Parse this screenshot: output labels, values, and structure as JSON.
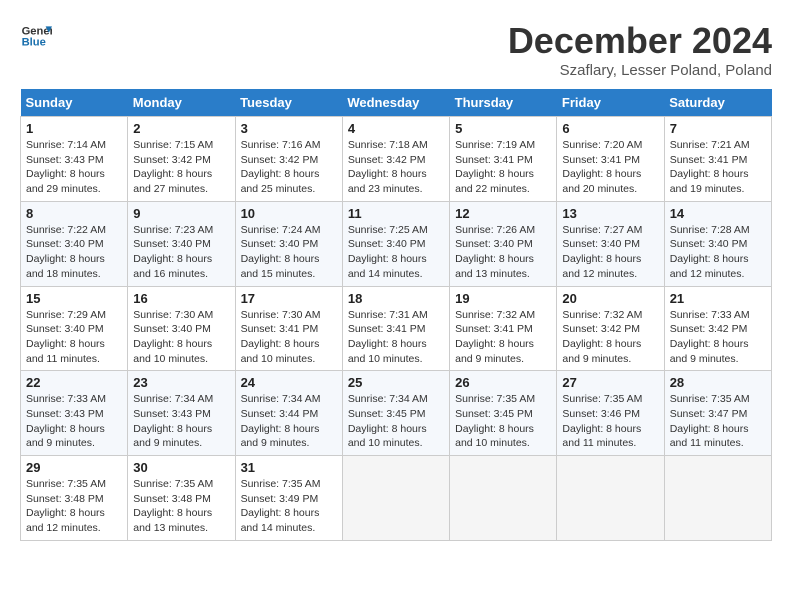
{
  "logo": {
    "line1": "General",
    "line2": "Blue"
  },
  "title": "December 2024",
  "subtitle": "Szaflary, Lesser Poland, Poland",
  "days_of_week": [
    "Sunday",
    "Monday",
    "Tuesday",
    "Wednesday",
    "Thursday",
    "Friday",
    "Saturday"
  ],
  "weeks": [
    [
      {
        "day": "1",
        "sunrise": "7:14 AM",
        "sunset": "3:43 PM",
        "daylight": "8 hours and 29 minutes."
      },
      {
        "day": "2",
        "sunrise": "7:15 AM",
        "sunset": "3:42 PM",
        "daylight": "8 hours and 27 minutes."
      },
      {
        "day": "3",
        "sunrise": "7:16 AM",
        "sunset": "3:42 PM",
        "daylight": "8 hours and 25 minutes."
      },
      {
        "day": "4",
        "sunrise": "7:18 AM",
        "sunset": "3:42 PM",
        "daylight": "8 hours and 23 minutes."
      },
      {
        "day": "5",
        "sunrise": "7:19 AM",
        "sunset": "3:41 PM",
        "daylight": "8 hours and 22 minutes."
      },
      {
        "day": "6",
        "sunrise": "7:20 AM",
        "sunset": "3:41 PM",
        "daylight": "8 hours and 20 minutes."
      },
      {
        "day": "7",
        "sunrise": "7:21 AM",
        "sunset": "3:41 PM",
        "daylight": "8 hours and 19 minutes."
      }
    ],
    [
      {
        "day": "8",
        "sunrise": "7:22 AM",
        "sunset": "3:40 PM",
        "daylight": "8 hours and 18 minutes."
      },
      {
        "day": "9",
        "sunrise": "7:23 AM",
        "sunset": "3:40 PM",
        "daylight": "8 hours and 16 minutes."
      },
      {
        "day": "10",
        "sunrise": "7:24 AM",
        "sunset": "3:40 PM",
        "daylight": "8 hours and 15 minutes."
      },
      {
        "day": "11",
        "sunrise": "7:25 AM",
        "sunset": "3:40 PM",
        "daylight": "8 hours and 14 minutes."
      },
      {
        "day": "12",
        "sunrise": "7:26 AM",
        "sunset": "3:40 PM",
        "daylight": "8 hours and 13 minutes."
      },
      {
        "day": "13",
        "sunrise": "7:27 AM",
        "sunset": "3:40 PM",
        "daylight": "8 hours and 12 minutes."
      },
      {
        "day": "14",
        "sunrise": "7:28 AM",
        "sunset": "3:40 PM",
        "daylight": "8 hours and 12 minutes."
      }
    ],
    [
      {
        "day": "15",
        "sunrise": "7:29 AM",
        "sunset": "3:40 PM",
        "daylight": "8 hours and 11 minutes."
      },
      {
        "day": "16",
        "sunrise": "7:30 AM",
        "sunset": "3:40 PM",
        "daylight": "8 hours and 10 minutes."
      },
      {
        "day": "17",
        "sunrise": "7:30 AM",
        "sunset": "3:41 PM",
        "daylight": "8 hours and 10 minutes."
      },
      {
        "day": "18",
        "sunrise": "7:31 AM",
        "sunset": "3:41 PM",
        "daylight": "8 hours and 10 minutes."
      },
      {
        "day": "19",
        "sunrise": "7:32 AM",
        "sunset": "3:41 PM",
        "daylight": "8 hours and 9 minutes."
      },
      {
        "day": "20",
        "sunrise": "7:32 AM",
        "sunset": "3:42 PM",
        "daylight": "8 hours and 9 minutes."
      },
      {
        "day": "21",
        "sunrise": "7:33 AM",
        "sunset": "3:42 PM",
        "daylight": "8 hours and 9 minutes."
      }
    ],
    [
      {
        "day": "22",
        "sunrise": "7:33 AM",
        "sunset": "3:43 PM",
        "daylight": "8 hours and 9 minutes."
      },
      {
        "day": "23",
        "sunrise": "7:34 AM",
        "sunset": "3:43 PM",
        "daylight": "8 hours and 9 minutes."
      },
      {
        "day": "24",
        "sunrise": "7:34 AM",
        "sunset": "3:44 PM",
        "daylight": "8 hours and 9 minutes."
      },
      {
        "day": "25",
        "sunrise": "7:34 AM",
        "sunset": "3:45 PM",
        "daylight": "8 hours and 10 minutes."
      },
      {
        "day": "26",
        "sunrise": "7:35 AM",
        "sunset": "3:45 PM",
        "daylight": "8 hours and 10 minutes."
      },
      {
        "day": "27",
        "sunrise": "7:35 AM",
        "sunset": "3:46 PM",
        "daylight": "8 hours and 11 minutes."
      },
      {
        "day": "28",
        "sunrise": "7:35 AM",
        "sunset": "3:47 PM",
        "daylight": "8 hours and 11 minutes."
      }
    ],
    [
      {
        "day": "29",
        "sunrise": "7:35 AM",
        "sunset": "3:48 PM",
        "daylight": "8 hours and 12 minutes."
      },
      {
        "day": "30",
        "sunrise": "7:35 AM",
        "sunset": "3:48 PM",
        "daylight": "8 hours and 13 minutes."
      },
      {
        "day": "31",
        "sunrise": "7:35 AM",
        "sunset": "3:49 PM",
        "daylight": "8 hours and 14 minutes."
      },
      null,
      null,
      null,
      null
    ]
  ],
  "labels": {
    "sunrise": "Sunrise:",
    "sunset": "Sunset:",
    "daylight": "Daylight:"
  }
}
